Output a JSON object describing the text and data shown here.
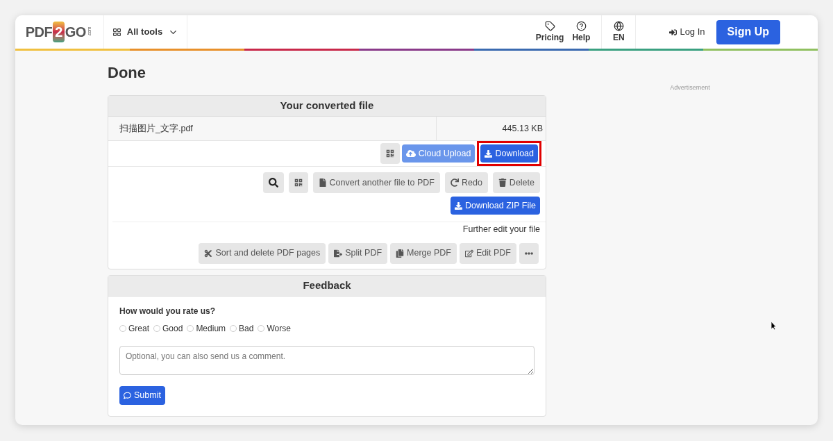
{
  "header": {
    "logo": {
      "left": "PDF",
      "middle": "2",
      "right": "GO",
      "suffix": ".com"
    },
    "all_tools": "All tools",
    "nav": [
      {
        "kind": "pricing",
        "label": "Pricing"
      },
      {
        "kind": "help",
        "label": "Help"
      }
    ],
    "language": "EN",
    "login": "Log In",
    "signup": "Sign Up"
  },
  "page_title": "Done",
  "advertisement": "Advertisement",
  "result": {
    "heading": "Your converted file",
    "file_name": "扫描图片_文字.pdf",
    "file_size": "445.13 KB",
    "cloud_upload": "Cloud Upload",
    "download": {
      "label": "Download",
      "highlighted": true
    },
    "actions": [
      {
        "kind": "search"
      },
      {
        "kind": "qr"
      },
      {
        "kind": "file",
        "label": "Convert another file to PDF"
      },
      {
        "kind": "redo",
        "label": "Redo"
      },
      {
        "kind": "delete",
        "label": "Delete"
      }
    ],
    "download_zip": "Download ZIP File",
    "further_edit": "Further edit your file",
    "tools": [
      {
        "kind": "cut",
        "label": "Sort and delete PDF pages"
      },
      {
        "kind": "split",
        "label": "Split PDF"
      },
      {
        "kind": "merge",
        "label": "Merge PDF"
      },
      {
        "kind": "edit",
        "label": "Edit PDF"
      },
      {
        "kind": "more"
      }
    ]
  },
  "feedback": {
    "heading": "Feedback",
    "question": "How would you rate us?",
    "ratings": [
      {
        "label": "Great",
        "selected": false
      },
      {
        "label": "Good",
        "selected": false
      },
      {
        "label": "Medium",
        "selected": false
      },
      {
        "label": "Bad",
        "selected": false
      },
      {
        "label": "Worse",
        "selected": false
      }
    ],
    "comment": {
      "placeholder": "Optional, you can also send us a comment."
    },
    "submit": "Submit"
  }
}
